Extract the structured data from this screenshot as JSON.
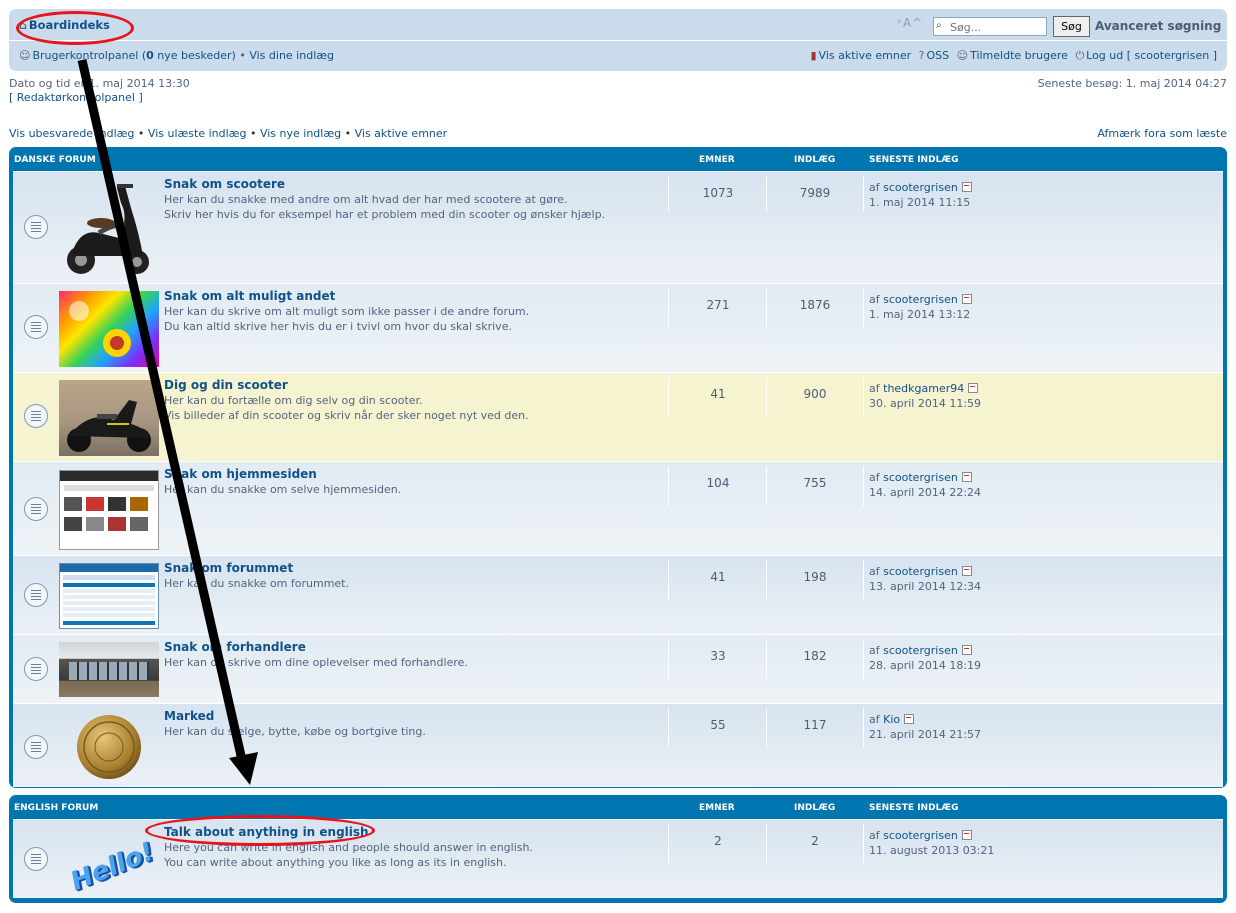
{
  "header": {
    "breadcrumb": "Boardindeks",
    "font_resize": "ᵛA^",
    "search_placeholder": "Søg...",
    "search_button": "Søg",
    "advanced_search": "Avanceret søgning",
    "ucp_prefix": "Brugerkontrolpanel (",
    "ucp_count": "0",
    "ucp_suffix": " nye beskeder)",
    "sep": " • ",
    "your_posts": "Vis dine indlæg",
    "active_topics": "Vis aktive emner",
    "faq": "OSS",
    "members": "Tilmeldte brugere",
    "logout": "Log ud [ scootergrisen ]"
  },
  "info": {
    "datetime": "Dato og tid er 1. maj 2014 13:30",
    "mcp": "[ Redaktørkontrolpanel ]",
    "last_visit": "Seneste besøg: 1. maj 2014 04:27"
  },
  "quicklinks": {
    "unanswered": "Vis ubesvarede indlæg",
    "unread": "Vis ulæste indlæg",
    "new": "Vis nye indlæg",
    "active": "Vis aktive emner",
    "sep": " • ",
    "mark_read": "Afmærk fora som læste"
  },
  "columns": {
    "topics": "EMNER",
    "posts": "INDLÆG",
    "last": "SENESTE INDLÆG"
  },
  "danish": {
    "title": "DANSKE FORUM",
    "forums": [
      {
        "title": "Snak om scootere",
        "desc1": "Her kan du snakke med andre om alt hvad der har med scootere at gøre.",
        "desc2": "Skriv her hvis du for eksempel har et problem med din scooter og ønsker hjælp.",
        "topics": "1073",
        "posts": "7989",
        "by": "af ",
        "user": "scootergrisen",
        "date": "1. maj 2014 11:15",
        "thumb": "scooter-photo"
      },
      {
        "title": "Snak om alt muligt andet",
        "desc1": "Her kan du skrive om alt muligt som ikke passer i de andre forum.",
        "desc2": "Du kan altid skrive her hvis du er i tvivl om hvor du skal skrive.",
        "topics": "271",
        "posts": "1876",
        "by": "af ",
        "user": "scootergrisen",
        "date": "1. maj 2014 13:12",
        "thumb": "rainbow-flower-photo"
      },
      {
        "title": "Dig og din scooter",
        "desc1": "Her kan du fortælle om dig selv og din scooter.",
        "desc2": "Vis billeder af din scooter og skriv når der sker noget nyt ved den.",
        "topics": "41",
        "posts": "900",
        "by": "af ",
        "user": "thedkgamer94",
        "date": "30. april 2014 11:59",
        "thumb": "black-scooter-photo"
      },
      {
        "title": "Snak om hjemmesiden",
        "desc1": "Her kan du snakke om selve hjemmesiden.",
        "desc2": "",
        "topics": "104",
        "posts": "755",
        "by": "af ",
        "user": "scootergrisen",
        "date": "14. april 2014 22:24",
        "thumb": "website-screenshot"
      },
      {
        "title": "Snak om forummet",
        "desc1": "Her kan du snakke om forummet.",
        "desc2": "",
        "topics": "41",
        "posts": "198",
        "by": "af ",
        "user": "scootergrisen",
        "date": "13. april 2014 12:34",
        "thumb": "forum-screenshot"
      },
      {
        "title": "Snak om forhandlere",
        "desc1": "Her kan du skrive om dine oplevelser med forhandlere.",
        "desc2": "",
        "topics": "33",
        "posts": "182",
        "by": "af ",
        "user": "scootergrisen",
        "date": "28. april 2014 18:19",
        "thumb": "shop-photo"
      },
      {
        "title": "Marked",
        "desc1": "Her kan du sælge, bytte, købe og bortgive ting.",
        "desc2": "",
        "topics": "55",
        "posts": "117",
        "by": "af ",
        "user": "Kio",
        "date": "21. april 2014 21:57",
        "thumb": "coin-photo"
      }
    ]
  },
  "english": {
    "title": "ENGLISH FORUM",
    "forums": [
      {
        "title": "Talk about anything in english",
        "desc1": "Here you can write in english and people should answer in english.",
        "desc2": "You can write about anything you like as long as its in english.",
        "topics": "2",
        "posts": "2",
        "by": "af ",
        "user": "scootergrisen",
        "date": "11. august 2013 03:21",
        "thumb": "hello-text-image",
        "thumb_text": "Hello!"
      }
    ]
  },
  "colors": {
    "panel_blue": "#0076b1",
    "header_bg": "#cadceb",
    "link": "#105289",
    "annotation_red": "#e8141b",
    "highlight_row": "#f6f4d0"
  }
}
